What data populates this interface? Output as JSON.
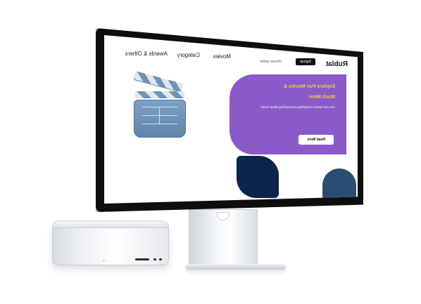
{
  "website": {
    "logo": "Rublat",
    "buttons": {
      "primary": "Signup",
      "cta": "Read More"
    },
    "menu_small_label": "choose option",
    "nav_links": [
      "Movies",
      "Category",
      "Awards & Others"
    ],
    "hero": {
      "title_line_1": "Explore Fun Movies &",
      "title_line_2": "Much More",
      "subtitle": "You can search everything and anything about movie"
    }
  },
  "icons": {
    "clapperboard": "clapperboard-icon"
  },
  "colors": {
    "hero_purple": "#8a5bc8",
    "hero_title": "#f7c54b",
    "blob_dark": "#0d2448",
    "blob_mid": "#2a4e72",
    "clapper_blue": "#7ea2c4"
  }
}
